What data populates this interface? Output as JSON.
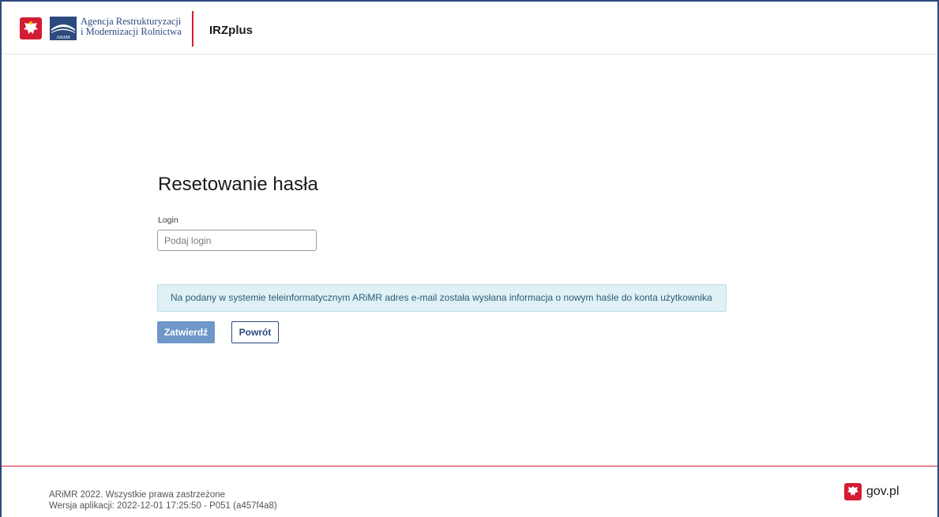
{
  "header": {
    "agency_line1": "Agencja Restrukturyzacji",
    "agency_line2": "i Modernizacji Rolnictwa",
    "logo_text": "ARiMR",
    "app_name": "IRZplus"
  },
  "form": {
    "title": "Resetowanie hasła",
    "login_label": "Login",
    "login_placeholder": "Podaj login",
    "login_value": "",
    "info_message": "Na podany w systemie teleinformatycznym ARiMR adres e-mail została wysłana informacja o nowym haśle do konta użytkownika",
    "submit_label": "Zatwierdź",
    "back_label": "Powrót"
  },
  "footer": {
    "copyright": "ARiMR 2022. Wszystkie prawa zastrzeżone",
    "version": "Wersja aplikacji: 2022-12-01 17:25:50 - P051 (a457f4a8)",
    "gov_label": "gov.pl"
  },
  "colors": {
    "brand_blue": "#2b4a7e",
    "accent_red": "#d41c32",
    "primary_button": "#6f97c8",
    "alert_bg": "#dff1f5"
  },
  "icons": {
    "emblem": "polish-eagle-emblem-icon",
    "agency_logo": "arimr-logo-icon",
    "gov_emblem": "polish-eagle-emblem-icon"
  }
}
